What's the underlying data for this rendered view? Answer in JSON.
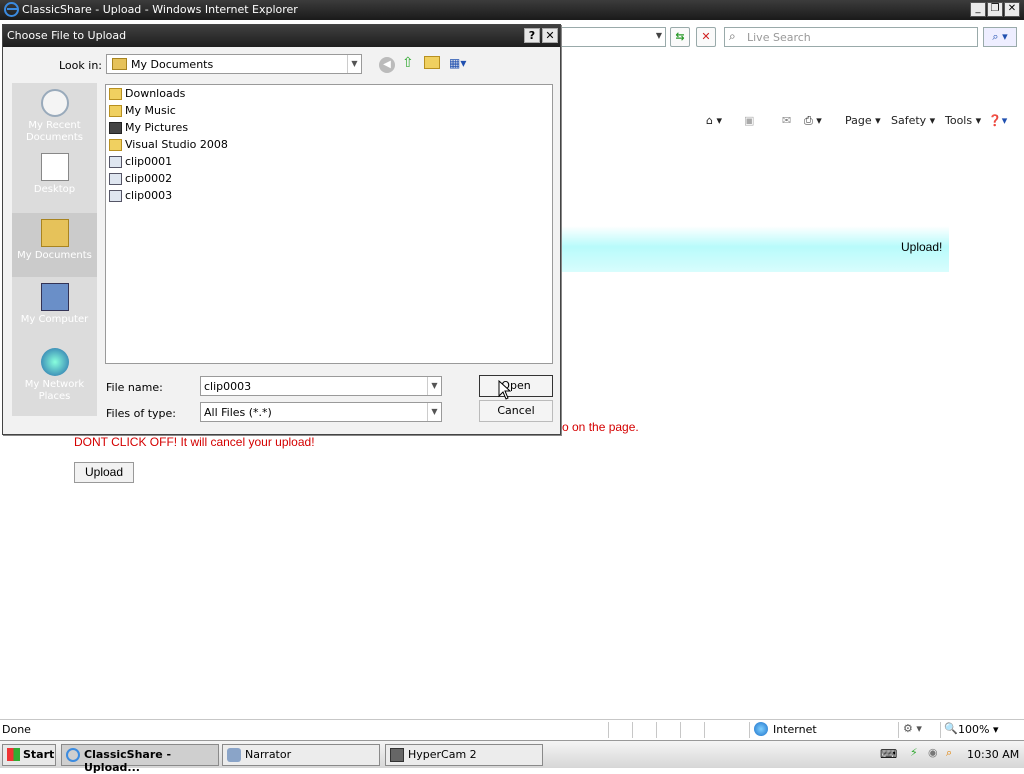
{
  "browser": {
    "title": "ClassicShare - Upload - Windows Internet Explorer",
    "search_placeholder": "Live Search",
    "commands": [
      "Page",
      "Safety",
      "Tools"
    ]
  },
  "page": {
    "banner_text": "Upload!",
    "notice_tail": "o on the page.",
    "warning": "DONT CLICK OFF! It will cancel your upload!",
    "upload_button": "Upload"
  },
  "dialog": {
    "title": "Choose File to Upload",
    "look_in_label": "Look in:",
    "look_in_value": "My Documents",
    "places": [
      "My Recent Documents",
      "Desktop",
      "My Documents",
      "My Computer",
      "My Network Places"
    ],
    "files": [
      {
        "name": "Downloads",
        "icon": "folder-icon"
      },
      {
        "name": "My Music",
        "icon": "music-folder-icon"
      },
      {
        "name": "My Pictures",
        "icon": "pictures-folder-icon"
      },
      {
        "name": "Visual Studio 2008",
        "icon": "folder-icon"
      },
      {
        "name": "clip0001",
        "icon": "video-file-icon"
      },
      {
        "name": "clip0002",
        "icon": "video-file-icon"
      },
      {
        "name": "clip0003",
        "icon": "video-file-icon"
      }
    ],
    "file_name_label": "File name:",
    "file_name_value": "clip0003",
    "file_type_label": "Files of type:",
    "file_type_value": "All Files (*.*)",
    "open_label": "Open",
    "cancel_label": "Cancel",
    "help_label": "?"
  },
  "status": {
    "text": "Done",
    "zone": "Internet",
    "zoom": "100%"
  },
  "taskbar": {
    "start": "Start",
    "tasks": [
      {
        "label": "ClassicShare - Upload...",
        "active": true
      },
      {
        "label": "Narrator",
        "active": false
      },
      {
        "label": "HyperCam 2",
        "active": false
      }
    ],
    "clock": "10:30 AM"
  }
}
